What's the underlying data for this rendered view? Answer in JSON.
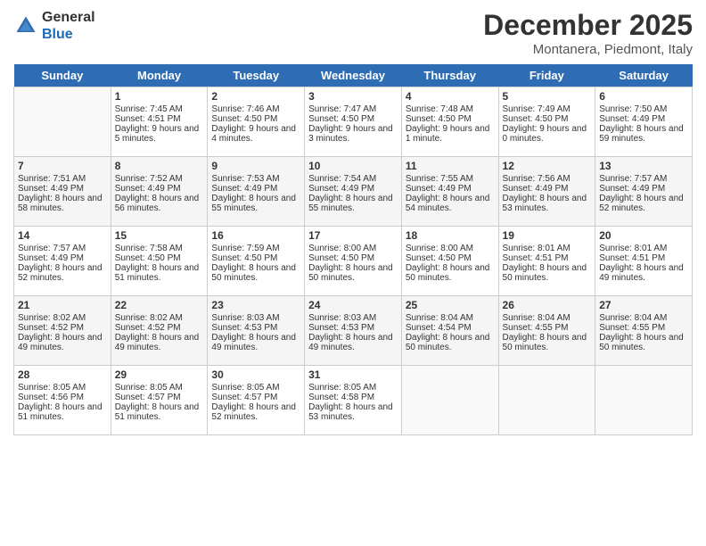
{
  "logo": {
    "general": "General",
    "blue": "Blue"
  },
  "title": "December 2025",
  "subtitle": "Montanera, Piedmont, Italy",
  "headers": [
    "Sunday",
    "Monday",
    "Tuesday",
    "Wednesday",
    "Thursday",
    "Friday",
    "Saturday"
  ],
  "weeks": [
    [
      {
        "day": "",
        "sunrise": "",
        "sunset": "",
        "daylight": ""
      },
      {
        "day": "1",
        "sunrise": "Sunrise: 7:45 AM",
        "sunset": "Sunset: 4:51 PM",
        "daylight": "Daylight: 9 hours and 5 minutes."
      },
      {
        "day": "2",
        "sunrise": "Sunrise: 7:46 AM",
        "sunset": "Sunset: 4:50 PM",
        "daylight": "Daylight: 9 hours and 4 minutes."
      },
      {
        "day": "3",
        "sunrise": "Sunrise: 7:47 AM",
        "sunset": "Sunset: 4:50 PM",
        "daylight": "Daylight: 9 hours and 3 minutes."
      },
      {
        "day": "4",
        "sunrise": "Sunrise: 7:48 AM",
        "sunset": "Sunset: 4:50 PM",
        "daylight": "Daylight: 9 hours and 1 minute."
      },
      {
        "day": "5",
        "sunrise": "Sunrise: 7:49 AM",
        "sunset": "Sunset: 4:50 PM",
        "daylight": "Daylight: 9 hours and 0 minutes."
      },
      {
        "day": "6",
        "sunrise": "Sunrise: 7:50 AM",
        "sunset": "Sunset: 4:49 PM",
        "daylight": "Daylight: 8 hours and 59 minutes."
      }
    ],
    [
      {
        "day": "7",
        "sunrise": "Sunrise: 7:51 AM",
        "sunset": "Sunset: 4:49 PM",
        "daylight": "Daylight: 8 hours and 58 minutes."
      },
      {
        "day": "8",
        "sunrise": "Sunrise: 7:52 AM",
        "sunset": "Sunset: 4:49 PM",
        "daylight": "Daylight: 8 hours and 56 minutes."
      },
      {
        "day": "9",
        "sunrise": "Sunrise: 7:53 AM",
        "sunset": "Sunset: 4:49 PM",
        "daylight": "Daylight: 8 hours and 55 minutes."
      },
      {
        "day": "10",
        "sunrise": "Sunrise: 7:54 AM",
        "sunset": "Sunset: 4:49 PM",
        "daylight": "Daylight: 8 hours and 55 minutes."
      },
      {
        "day": "11",
        "sunrise": "Sunrise: 7:55 AM",
        "sunset": "Sunset: 4:49 PM",
        "daylight": "Daylight: 8 hours and 54 minutes."
      },
      {
        "day": "12",
        "sunrise": "Sunrise: 7:56 AM",
        "sunset": "Sunset: 4:49 PM",
        "daylight": "Daylight: 8 hours and 53 minutes."
      },
      {
        "day": "13",
        "sunrise": "Sunrise: 7:57 AM",
        "sunset": "Sunset: 4:49 PM",
        "daylight": "Daylight: 8 hours and 52 minutes."
      }
    ],
    [
      {
        "day": "14",
        "sunrise": "Sunrise: 7:57 AM",
        "sunset": "Sunset: 4:49 PM",
        "daylight": "Daylight: 8 hours and 52 minutes."
      },
      {
        "day": "15",
        "sunrise": "Sunrise: 7:58 AM",
        "sunset": "Sunset: 4:50 PM",
        "daylight": "Daylight: 8 hours and 51 minutes."
      },
      {
        "day": "16",
        "sunrise": "Sunrise: 7:59 AM",
        "sunset": "Sunset: 4:50 PM",
        "daylight": "Daylight: 8 hours and 50 minutes."
      },
      {
        "day": "17",
        "sunrise": "Sunrise: 8:00 AM",
        "sunset": "Sunset: 4:50 PM",
        "daylight": "Daylight: 8 hours and 50 minutes."
      },
      {
        "day": "18",
        "sunrise": "Sunrise: 8:00 AM",
        "sunset": "Sunset: 4:50 PM",
        "daylight": "Daylight: 8 hours and 50 minutes."
      },
      {
        "day": "19",
        "sunrise": "Sunrise: 8:01 AM",
        "sunset": "Sunset: 4:51 PM",
        "daylight": "Daylight: 8 hours and 50 minutes."
      },
      {
        "day": "20",
        "sunrise": "Sunrise: 8:01 AM",
        "sunset": "Sunset: 4:51 PM",
        "daylight": "Daylight: 8 hours and 49 minutes."
      }
    ],
    [
      {
        "day": "21",
        "sunrise": "Sunrise: 8:02 AM",
        "sunset": "Sunset: 4:52 PM",
        "daylight": "Daylight: 8 hours and 49 minutes."
      },
      {
        "day": "22",
        "sunrise": "Sunrise: 8:02 AM",
        "sunset": "Sunset: 4:52 PM",
        "daylight": "Daylight: 8 hours and 49 minutes."
      },
      {
        "day": "23",
        "sunrise": "Sunrise: 8:03 AM",
        "sunset": "Sunset: 4:53 PM",
        "daylight": "Daylight: 8 hours and 49 minutes."
      },
      {
        "day": "24",
        "sunrise": "Sunrise: 8:03 AM",
        "sunset": "Sunset: 4:53 PM",
        "daylight": "Daylight: 8 hours and 49 minutes."
      },
      {
        "day": "25",
        "sunrise": "Sunrise: 8:04 AM",
        "sunset": "Sunset: 4:54 PM",
        "daylight": "Daylight: 8 hours and 50 minutes."
      },
      {
        "day": "26",
        "sunrise": "Sunrise: 8:04 AM",
        "sunset": "Sunset: 4:55 PM",
        "daylight": "Daylight: 8 hours and 50 minutes."
      },
      {
        "day": "27",
        "sunrise": "Sunrise: 8:04 AM",
        "sunset": "Sunset: 4:55 PM",
        "daylight": "Daylight: 8 hours and 50 minutes."
      }
    ],
    [
      {
        "day": "28",
        "sunrise": "Sunrise: 8:05 AM",
        "sunset": "Sunset: 4:56 PM",
        "daylight": "Daylight: 8 hours and 51 minutes."
      },
      {
        "day": "29",
        "sunrise": "Sunrise: 8:05 AM",
        "sunset": "Sunset: 4:57 PM",
        "daylight": "Daylight: 8 hours and 51 minutes."
      },
      {
        "day": "30",
        "sunrise": "Sunrise: 8:05 AM",
        "sunset": "Sunset: 4:57 PM",
        "daylight": "Daylight: 8 hours and 52 minutes."
      },
      {
        "day": "31",
        "sunrise": "Sunrise: 8:05 AM",
        "sunset": "Sunset: 4:58 PM",
        "daylight": "Daylight: 8 hours and 53 minutes."
      },
      {
        "day": "",
        "sunrise": "",
        "sunset": "",
        "daylight": ""
      },
      {
        "day": "",
        "sunrise": "",
        "sunset": "",
        "daylight": ""
      },
      {
        "day": "",
        "sunrise": "",
        "sunset": "",
        "daylight": ""
      }
    ]
  ]
}
